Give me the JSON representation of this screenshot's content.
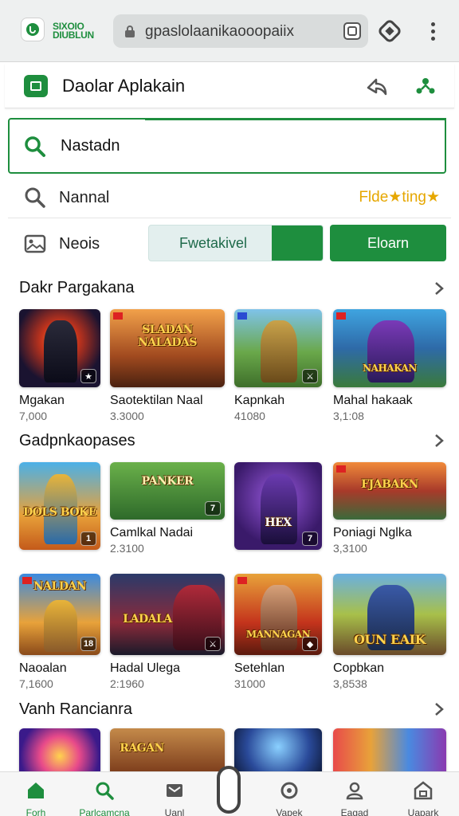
{
  "browser": {
    "brand_line1": "SIXOIO",
    "brand_line2": "DIUBLUN",
    "url": "gpaslolaanikaooopaiix"
  },
  "app": {
    "title": "Daolar Aplakain"
  },
  "search": {
    "value": "Nastadn",
    "row2_label": "Nannal",
    "row2_tag": "Flde★ting★",
    "row3_label": "Neois",
    "toggle_a": "Fwetakivel",
    "toggle_b": "Eloarn"
  },
  "sections": [
    {
      "title": "Dakr Pargakana",
      "items": [
        {
          "name": "Mgakan",
          "count": "7,000"
        },
        {
          "name": "Saotektilan Naal",
          "count": "3.3000",
          "logo": "SLADAN NALADAS"
        },
        {
          "name": "Kapnkah",
          "count": "41080"
        },
        {
          "name": "Mahal hakaak",
          "count": "3,1:08",
          "logo": "NAHAKAN"
        }
      ]
    },
    {
      "title": "Gadpnkaopases",
      "items": [
        {
          "name": "",
          "count": "",
          "logo": "DOLS BOKE",
          "badge": "1"
        },
        {
          "name": "Camlkal Nadai",
          "count": "2.3100",
          "logo": "PANKER",
          "badge": "7"
        },
        {
          "name": "",
          "count": "",
          "logo": "HEX",
          "badge": "7"
        },
        {
          "name": "Poniagi Nglka",
          "count": "3,3100",
          "logo": "FJABAKN"
        }
      ]
    },
    {
      "title": "",
      "items": [
        {
          "name": "Naoalan",
          "count": "7,1600",
          "logo": "NALDAN",
          "badge": "18"
        },
        {
          "name": "Hadal Ulega",
          "count": "2:1960",
          "logo": "LADALA"
        },
        {
          "name": "Setehlan",
          "count": "31000",
          "logo": "MANNAGAN"
        },
        {
          "name": "Copbkan",
          "count": "3,8538",
          "logo": "OUN EAIK"
        }
      ]
    },
    {
      "title": "Vanh Rancianra",
      "items": [
        {
          "name": "",
          "count": ""
        },
        {
          "name": "",
          "count": "",
          "logo": "RAGAN"
        },
        {
          "name": "",
          "count": ""
        },
        {
          "name": "",
          "count": ""
        }
      ]
    }
  ],
  "nav": [
    {
      "label": "Forh",
      "icon": "home-icon",
      "active": true
    },
    {
      "label": "Parlcamcna",
      "icon": "search-icon",
      "active": true
    },
    {
      "label": "Uanl",
      "icon": "inbox-icon"
    },
    {
      "label": "Vapek",
      "icon": "circle-icon"
    },
    {
      "label": "Eagad",
      "icon": "person-icon"
    },
    {
      "label": "Uapark",
      "icon": "store-icon"
    }
  ],
  "colors": {
    "accent": "#1e8e3e",
    "tag": "#e6a700"
  }
}
